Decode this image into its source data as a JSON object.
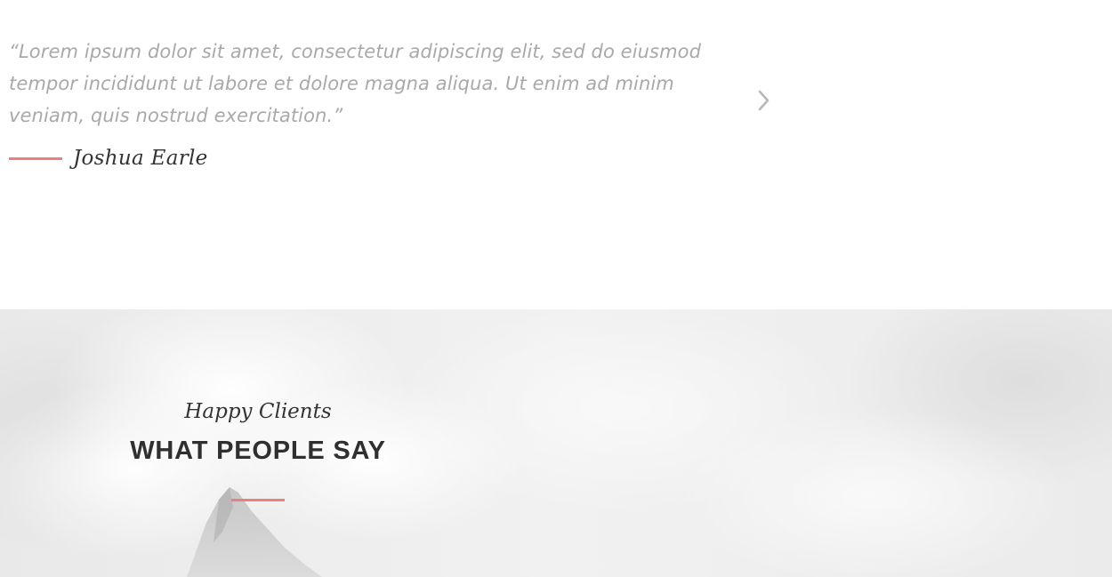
{
  "testimonial": {
    "quote": "“Lorem ipsum dolor sit amet, consectetur adipiscing elit, sed do eiusmod tempor incididunt ut labore et dolore magna aliqua. Ut enim ad minim veniam, quis nostrud exercitation.”",
    "author": "Joshua Earle",
    "next_icon": "chevron-right-icon"
  },
  "section": {
    "subtitle": "Happy Clients",
    "title": "WHAT PEOPLE SAY"
  },
  "colors": {
    "accent": "#e8807f",
    "quote_text": "#a9a9a9",
    "heading": "#2f2f2f",
    "hero_background": "#f0f0f0"
  }
}
